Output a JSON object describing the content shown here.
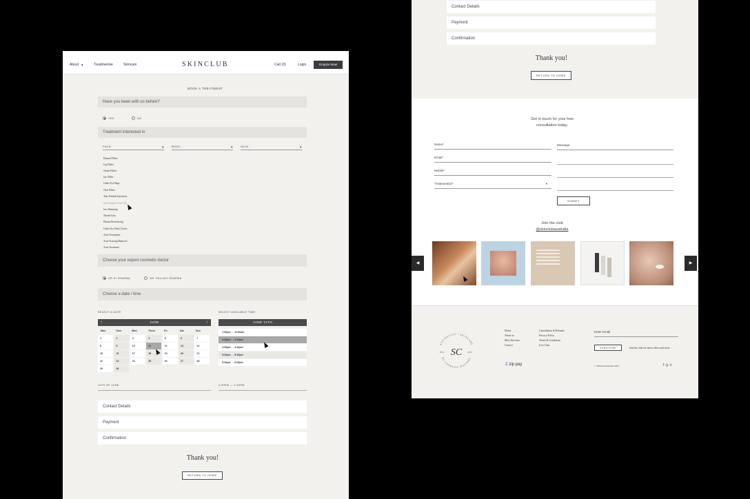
{
  "nav": {
    "about": "About",
    "treatments": "Treatments",
    "skincare": "Skincare",
    "logo": "SKINCLUB",
    "cart": "Cart (0)",
    "login": "Login",
    "enquire": "Enquire Now"
  },
  "booking": {
    "heading": "BOOK A TREATMENT",
    "q1": "Have you been with us before?",
    "yes": "YES",
    "no": "NO",
    "q2": "Treatment interested in",
    "face": "FACE",
    "body": "BODY",
    "skin": "SKIN",
    "treatments": [
      "Dermal Fillers",
      "Lip Fillers",
      "Cheek Fillers",
      "Jaw Filler",
      "Under Eye Bags",
      "Chin Fillers",
      "Anti-Wrinkle Injections",
      "Non-Surgical Nose Job",
      "Jaw Slimming",
      "Thread Lifts",
      "Plasma Resurfacing",
      "Under Eye Dark Circles",
      "Acne Treatments",
      "Acne Scarring Removal",
      "Acne Treatment"
    ],
    "q3": "Choose your expert cosmetic doctor",
    "doc1": "DR VI SHARMA",
    "doc2": "DR. PALLAVI SHARMA",
    "q4": "Choose a date / time",
    "select_date": "SELECT A DATE",
    "select_time": "SELECT AVAILABLE TIME",
    "month": "JUNE",
    "time_header": "JUNE 11TH",
    "weekdays": [
      "Mon",
      "Tues",
      "Wed",
      "Thurs",
      "Fri",
      "Sat",
      "Sun"
    ],
    "days": [
      "1",
      "2",
      "3",
      "4",
      "5",
      "6",
      "7",
      "8",
      "9",
      "10",
      "11",
      "12",
      "13",
      "14",
      "15",
      "16",
      "17",
      "18",
      "19",
      "20",
      "21",
      "22",
      "23",
      "24",
      "25",
      "26",
      "27",
      "28",
      "29",
      "30"
    ],
    "slots": [
      "1:00pm → 11:30am",
      "2:00pm → 2:30pm",
      "4:00pm → 4:30pm",
      "5:00pm → 5:30pm",
      "5:30pm → 6:00pm"
    ],
    "chosen_date": "11TH OF JUNE",
    "chosen_time": "2:00PM — 2:30PM",
    "contact": "Contact Details",
    "payment": "Payment",
    "confirmation": "Confirmation",
    "thanks": "Thank you!",
    "return": "RETURN TO HOME"
  },
  "right": {
    "contact": "Contact Details",
    "payment": "Payment",
    "confirmation": "Confirmation",
    "thanks": "Thank you!",
    "return": "RETURN TO HOME",
    "consult_line1": "Get in touch for your free",
    "consult_line2": "consultation today.",
    "name": "Name*",
    "email": "Email*",
    "mobile": "Mobile*",
    "treatment": "Treatment(s)*",
    "message": "Message",
    "submit": "SUBMIT",
    "join1": "Join the club",
    "join2": "@skinclubaustralia",
    "footer_links1": [
      "Home",
      "About us",
      "Meet the team",
      "Contact"
    ],
    "footer_links2": [
      "Cancellation & Refunds",
      "Privacy Policy",
      "Terms & Conditions",
      "Live Chat"
    ],
    "enter_email": "Enter Email",
    "subscribe": "SUBSCRIBE",
    "sub_note": "Join the club for latest offers and news.",
    "copyright": "© Skinclub Australia 2021",
    "zip": "zip pay",
    "seal_est": "EST.",
    "seal_year": "2015",
    "seal_top": "AESTHETICS • SKINCARE",
    "seal_bottom": "BY COSMETIC DOCTORS"
  },
  "colors": {
    "dark": "#3d3d3d",
    "panel": "#f2f1ee",
    "band": "#e4e3e0",
    "selected": "#a8a8a8"
  }
}
